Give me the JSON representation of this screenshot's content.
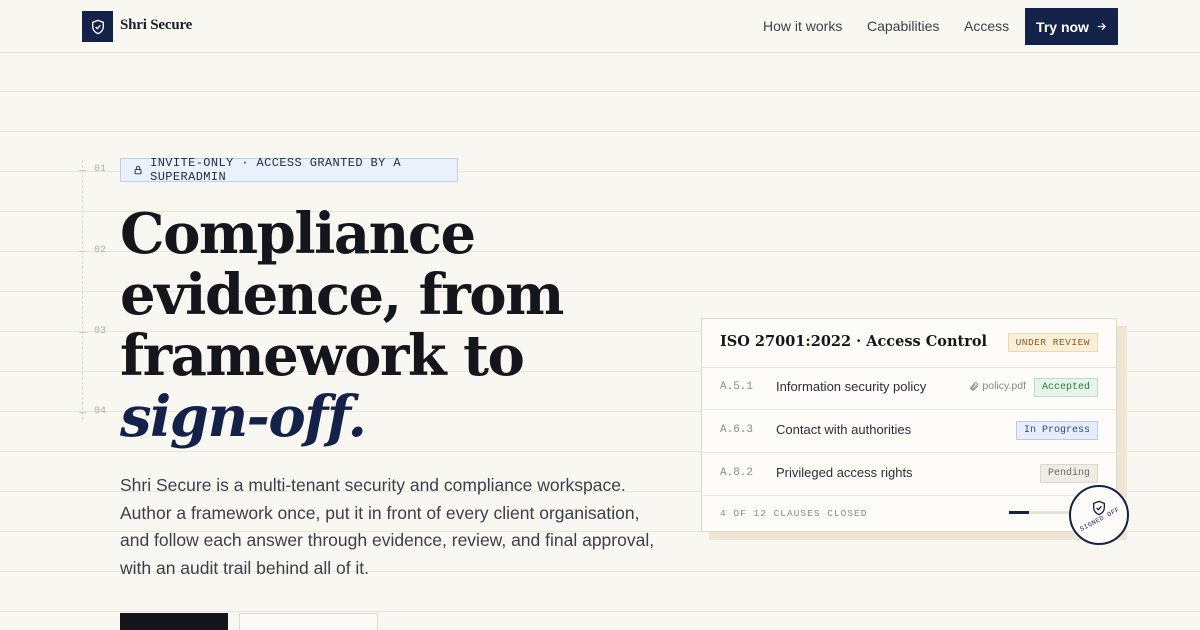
{
  "brand": {
    "name": "Shri Secure"
  },
  "nav": {
    "links": [
      "How it works",
      "Capabilities",
      "Access"
    ],
    "cta_label": "Try now"
  },
  "rail": [
    "01",
    "02",
    "03",
    "04"
  ],
  "hero": {
    "badge": "INVITE-ONLY · ACCESS GRANTED BY A SUPERADMIN",
    "headline_lines": [
      "Compliance",
      "evidence, from",
      "framework to"
    ],
    "headline_accent": "sign-off.",
    "lede": "Shri Secure is a multi-tenant security and compliance workspace. Author a framework once, put it in front of every client organisation, and follow each answer through evidence, review, and final approval, with an audit trail behind all of it."
  },
  "card": {
    "title": "ISO 27001:2022 · Access Control",
    "status_badge": "UNDER REVIEW",
    "rows": [
      {
        "code": "A.5.1",
        "title": "Information security policy",
        "attachment": "policy.pdf",
        "status": "Accepted"
      },
      {
        "code": "A.6.3",
        "title": "Contact with authorities",
        "attachment": "",
        "status": "In Progress"
      },
      {
        "code": "A.8.2",
        "title": "Privileged access rights",
        "attachment": "",
        "status": "Pending"
      }
    ],
    "footer": "4 OF 12 CLAUSES CLOSED",
    "progress_fraction": 0.33,
    "seal_label": "SIGNED OFF"
  },
  "colors": {
    "background": "#f9f7f1",
    "navy": "#14224a",
    "accepted": "#2d7a45",
    "in_progress": "#274a86",
    "under_review": "#8a5a17"
  }
}
